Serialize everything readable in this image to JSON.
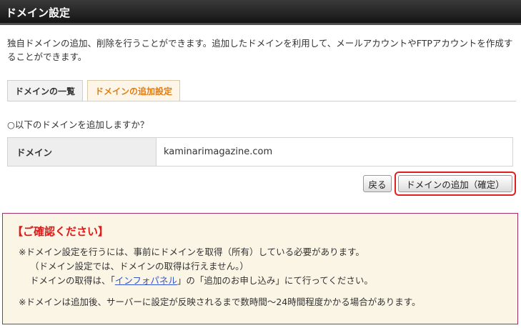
{
  "header": {
    "title": "ドメイン設定"
  },
  "description": "独自ドメインの追加、削除を行うことができます。追加したドメインを利用して、メールアカウントやFTPアカウントを作成することができます。",
  "tabs": [
    {
      "label": "ドメインの一覧",
      "active": false
    },
    {
      "label": "ドメインの追加設定",
      "active": true
    }
  ],
  "question": "○以下のドメインを追加しますか？",
  "domain_table": {
    "label": "ドメイン",
    "value": "kaminarimagazine.com"
  },
  "buttons": {
    "back": "戻る",
    "confirm": "ドメインの追加（確定）"
  },
  "notice": {
    "title": "【ご確認ください】",
    "line1": "※ドメイン設定を行うには、事前にドメインを取得（所有）している必要があります。",
    "line2": "（ドメイン設定では、ドメインの取得は行えません。）",
    "line3_before": "ドメインの取得は、「",
    "line3_link": "インフォパネル",
    "line3_after": "」の「追加のお申し込み」にて行ってください。",
    "line4": "※ドメインは追加後、サーバーに設定が反映されるまで数時間〜24時間程度かかる場合があります。"
  },
  "colors": {
    "accent_orange": "#e27d10",
    "alert_red": "#e01818",
    "notice_border": "#a1306a"
  }
}
